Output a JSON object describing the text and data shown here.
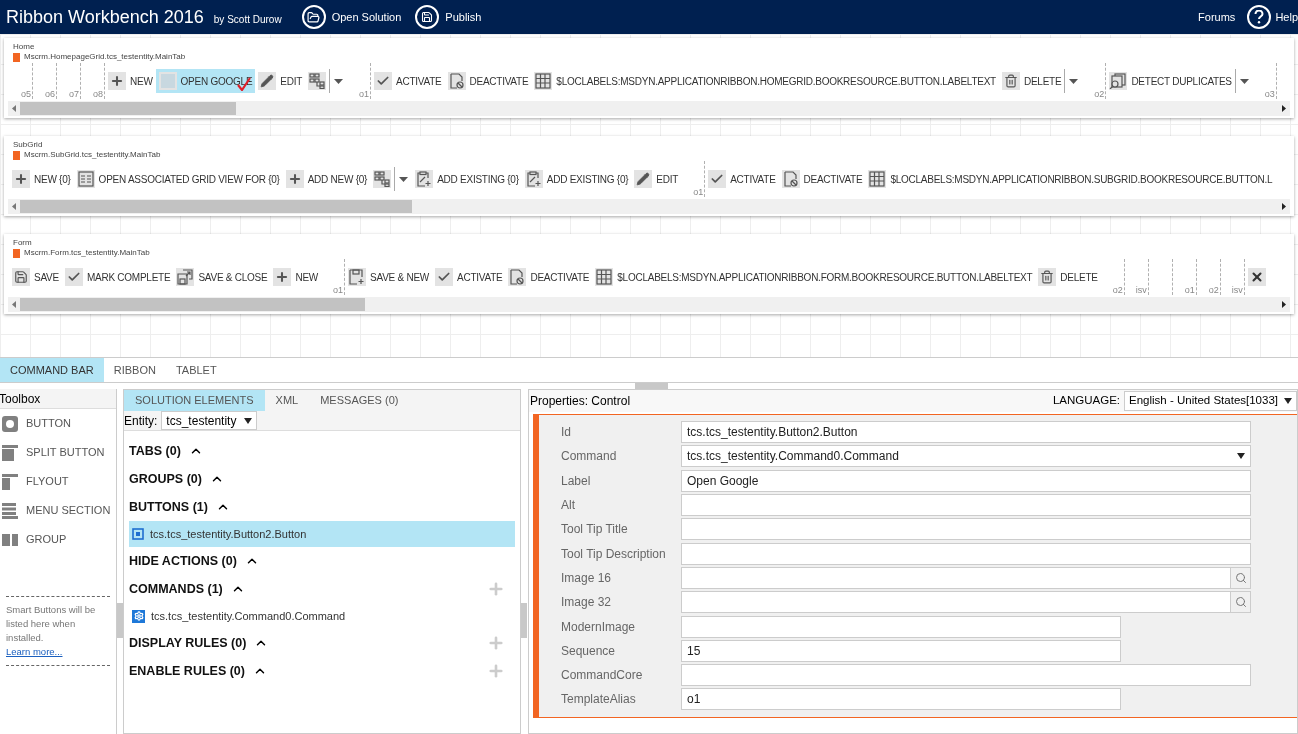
{
  "app": {
    "title": "Ribbon Workbench 2016",
    "byline": "by Scott Durow",
    "actions": [
      {
        "label": "Open Solution",
        "kind": "folder"
      },
      {
        "label": "Publish",
        "kind": "floppy"
      }
    ],
    "links": [
      {
        "label": "Forums",
        "kind": "text"
      },
      {
        "label": "Help",
        "kind": "help"
      }
    ]
  },
  "ribbons": [
    {
      "title": "Home",
      "tab": "Mscrm.HomepageGrid.tcs_testentity.MainTab",
      "items": [
        {
          "kind": "marker",
          "label": "o5"
        },
        {
          "kind": "marker",
          "label": "o6"
        },
        {
          "kind": "marker",
          "label": "o7"
        },
        {
          "kind": "marker",
          "label": "o8"
        },
        {
          "kind": "plus",
          "label": "NEW",
          "selected": false
        },
        {
          "kind": "blank",
          "label": "OPEN GOOGLE",
          "selected": true
        },
        {
          "kind": "pencil",
          "label": "EDIT",
          "selected": false
        },
        {
          "kind": "tree"
        },
        {
          "kind": "caret"
        },
        {
          "kind": "marker",
          "label": "o1"
        },
        {
          "kind": "check",
          "label": "ACTIVATE",
          "selected": false
        },
        {
          "kind": "deactivate",
          "label": "DEACTIVATE",
          "selected": false
        },
        {
          "kind": "grid",
          "label": "$LOCLABELS:MSDYN.APPLICATIONRIBBON.HOMEGRID.BOOKRESOURCE.BUTTON.LABELTEXT",
          "selected": false
        },
        {
          "kind": "trash",
          "label": "DELETE",
          "selected": false
        },
        {
          "kind": "caret"
        },
        {
          "kind": "marker",
          "label": "o2"
        },
        {
          "kind": "duplicates",
          "label": "DETECT DUPLICATES",
          "selected": false
        },
        {
          "kind": "caret"
        },
        {
          "kind": "marker",
          "label": "o3"
        }
      ]
    },
    {
      "title": "SubGrid",
      "tab": "Mscrm.SubGrid.tcs_testentity.MainTab",
      "items": [
        {
          "kind": "plus",
          "label": "NEW {0}",
          "selected": false
        },
        {
          "kind": "list",
          "label": "OPEN ASSOCIATED GRID VIEW FOR {0}",
          "selected": false
        },
        {
          "kind": "plus",
          "label": "ADD NEW {0}",
          "selected": false
        },
        {
          "kind": "tree"
        },
        {
          "kind": "caret"
        },
        {
          "kind": "clipboard",
          "label": "ADD EXISTING {0}",
          "selected": false
        },
        {
          "kind": "clipboard",
          "label": "ADD EXISTING {0}",
          "selected": false
        },
        {
          "kind": "pencil",
          "label": "EDIT",
          "selected": false
        },
        {
          "kind": "marker",
          "label": "o1"
        },
        {
          "kind": "check",
          "label": "ACTIVATE",
          "selected": false
        },
        {
          "kind": "deactivate",
          "label": "DEACTIVATE",
          "selected": false
        },
        {
          "kind": "grid",
          "label": "$LOCLABELS:MSDYN.APPLICATIONRIBBON.SUBGRID.BOOKRESOURCE.BUTTON.L",
          "selected": false
        }
      ]
    },
    {
      "title": "Form",
      "tab": "Mscrm.Form.tcs_testentity.MainTab",
      "items": [
        {
          "kind": "save",
          "label": "SAVE",
          "selected": false
        },
        {
          "kind": "check",
          "label": "MARK COMPLETE",
          "selected": false
        },
        {
          "kind": "saveclose",
          "label": "SAVE & CLOSE",
          "selected": false
        },
        {
          "kind": "plus",
          "label": "NEW",
          "selected": false
        },
        {
          "kind": "marker",
          "label": "o1"
        },
        {
          "kind": "savenew",
          "label": "SAVE & NEW",
          "selected": false
        },
        {
          "kind": "check",
          "label": "ACTIVATE",
          "selected": false
        },
        {
          "kind": "deactivate",
          "label": "DEACTIVATE",
          "selected": false
        },
        {
          "kind": "grid",
          "label": "$LOCLABELS:MSDYN.APPLICATIONRIBBON.FORM.BOOKRESOURCE.BUTTON.LABELTEXT",
          "selected": false
        },
        {
          "kind": "trash",
          "label": "DELETE",
          "selected": false
        },
        {
          "kind": "marker",
          "label": "o2"
        },
        {
          "kind": "marker",
          "label": "isv"
        },
        {
          "kind": "marker"
        },
        {
          "kind": "marker",
          "label": "o1"
        },
        {
          "kind": "marker",
          "label": "o2"
        },
        {
          "kind": "marker",
          "label": "isv"
        },
        {
          "kind": "close"
        }
      ]
    }
  ],
  "designer_tabs": [
    {
      "label": "COMMAND BAR",
      "selected": true
    },
    {
      "label": "RIBBON",
      "selected": false
    },
    {
      "label": "TABLET",
      "selected": false
    }
  ],
  "toolbox": {
    "title": "Toolbox",
    "items": [
      {
        "label": "BUTTON",
        "kind": "button"
      },
      {
        "label": "SPLIT BUTTON",
        "kind": "split"
      },
      {
        "label": "FLYOUT",
        "kind": "flyout"
      },
      {
        "label": "MENU SECTION",
        "kind": "menu"
      },
      {
        "label": "GROUP",
        "kind": "group"
      }
    ],
    "note": "Smart Buttons will be listed here when installed.",
    "link": "Learn more..."
  },
  "solution": {
    "tabs": [
      {
        "label": "SOLUTION ELEMENTS",
        "selected": true
      },
      {
        "label": "XML",
        "selected": false
      },
      {
        "label": "MESSAGES (0)",
        "selected": false
      }
    ],
    "entity_label": "Entity:",
    "entity": "tcs_testentity",
    "sections": [
      {
        "label": "TABS (0)",
        "expanded": true,
        "can_add": false
      },
      {
        "label": "GROUPS (0)",
        "expanded": true,
        "can_add": false
      },
      {
        "label": "BUTTONS (1)",
        "expanded": true,
        "can_add": false,
        "children": [
          {
            "label": "tcs.tcs_testentity.Button2.Button",
            "kind": "button",
            "selected": true
          }
        ]
      },
      {
        "label": "HIDE ACTIONS (0)",
        "expanded": true,
        "can_add": false
      },
      {
        "label": "COMMANDS (1)",
        "expanded": true,
        "can_add": true,
        "children": [
          {
            "label": "tcs.tcs_testentity.Command0.Command",
            "kind": "command",
            "selected": false
          }
        ]
      },
      {
        "label": "DISPLAY RULES (0)",
        "expanded": true,
        "can_add": true
      },
      {
        "label": "ENABLE RULES (0)",
        "expanded": true,
        "can_add": true
      }
    ]
  },
  "properties": {
    "title": "Properties: Control",
    "language_label": "LANGUAGE:",
    "language": "English - United States[1033]",
    "fields": [
      {
        "label": "Id",
        "kind": "text",
        "value": "tcs.tcs_testentity.Button2.Button"
      },
      {
        "label": "Command",
        "kind": "select",
        "value": "tcs.tcs_testentity.Command0.Command"
      },
      {
        "label": "Label",
        "kind": "text",
        "value": "Open Google"
      },
      {
        "label": "Alt",
        "kind": "text"
      },
      {
        "label": "Tool Tip Title",
        "kind": "text"
      },
      {
        "label": "Tool Tip Description",
        "kind": "text"
      },
      {
        "label": "Image 16",
        "kind": "image"
      },
      {
        "label": "Image 32",
        "kind": "image"
      },
      {
        "label": "ModernImage",
        "kind": "short"
      },
      {
        "label": "Sequence",
        "kind": "short",
        "value": "15"
      },
      {
        "label": "CommandCore",
        "kind": "text"
      },
      {
        "label": "TemplateAlias",
        "kind": "short",
        "value": "o1"
      }
    ]
  }
}
